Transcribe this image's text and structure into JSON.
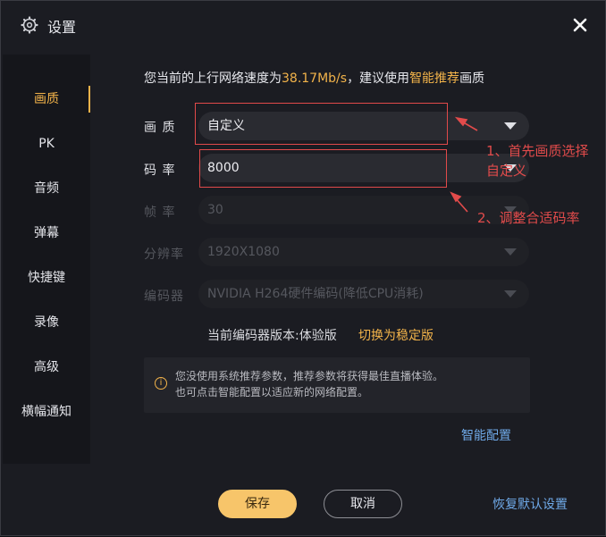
{
  "window": {
    "title": "设置",
    "close_label": "✕"
  },
  "sidebar": {
    "items": [
      {
        "label": "画质",
        "active": true
      },
      {
        "label": "PK"
      },
      {
        "label": "音频"
      },
      {
        "label": "弹幕"
      },
      {
        "label": "快捷键"
      },
      {
        "label": "录像"
      },
      {
        "label": "高级"
      },
      {
        "label": "横幅通知"
      }
    ]
  },
  "quality": {
    "speed_prefix": "您当前的上行网络速度为",
    "speed_value": "38.17Mb/s",
    "speed_middle": "，建议使用",
    "speed_recommend": "智能推荐",
    "speed_suffix": "画质",
    "rows": {
      "quality": {
        "label": "画 质",
        "value": "自定义"
      },
      "bitrate": {
        "label": "码 率",
        "value": "8000"
      },
      "framerate": {
        "label": "帧 率",
        "value": "30"
      },
      "resolution": {
        "label": "分辨率",
        "value": "1920X1080"
      },
      "encoder": {
        "label": "编码器",
        "value": "NVIDIA H264硬件编码(降低CPU消耗)"
      }
    },
    "encoder_version": "当前编码器版本:体验版",
    "switch_stable": "切换为稳定版",
    "info_line1": "您没使用系统推荐参数，推荐参数将获得最佳直播体验。",
    "info_line2": "也可点击智能配置以适应新的网络配置。",
    "info_icon": "i",
    "smart_config": "智能配置"
  },
  "annotations": {
    "step1_line1": "1、首先画质选择",
    "step1_line2": "自定义",
    "step2": "2、调整合适码率",
    "color": "#e24b4b"
  },
  "footer": {
    "save": "保存",
    "cancel": "取消",
    "reset": "恢复默认设置"
  },
  "colors": {
    "accent": "#f2b34a",
    "link": "#6fa9e8",
    "bg": "#1b1c22"
  }
}
